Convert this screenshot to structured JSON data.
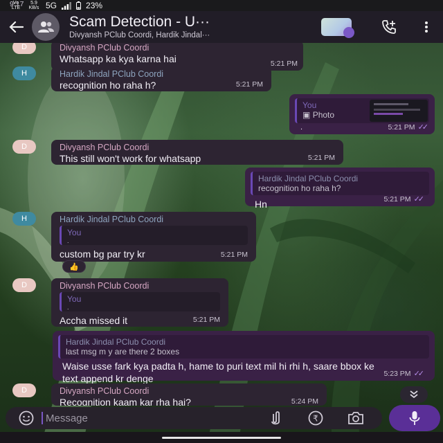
{
  "status_bar": {
    "time": "9:17",
    "volte": "Vo LTE",
    "data_speed": "5.9",
    "data_unit": "KB/s",
    "network": "5G",
    "battery": "23%"
  },
  "header": {
    "title": "Scam Detection - U···",
    "subtitle": "Divyansh PClub Coordi, Hardik Jindal···",
    "icons": [
      "back-arrow-icon",
      "group-icon",
      "call-add-icon",
      "more-vert-icon"
    ]
  },
  "messages": [
    {
      "type": "in",
      "avatar": "D",
      "sender": "Divyansh PClub Coordi",
      "text": "Whatsapp ka kya karna hai",
      "time": "5:21 PM"
    },
    {
      "type": "in",
      "avatar": "H",
      "sender": "Hardik Jindal PClub Coordi",
      "text": "recognition ho raha h?",
      "time": "5:21 PM"
    },
    {
      "type": "out",
      "quote_name": "You",
      "quote_text": "Photo",
      "text": ".",
      "time": "5:21 PM"
    },
    {
      "type": "in",
      "avatar": "D",
      "sender": "Divyansh PClub Coordi",
      "text": "This still won't work for whatsapp",
      "time": "5:21 PM"
    },
    {
      "type": "out",
      "quote_name": "Hardik Jindal PClub Coordi",
      "quote_text": "recognition ho raha h?",
      "text": "Hn",
      "time": "5:21 PM"
    },
    {
      "type": "in",
      "avatar": "H",
      "sender": "Hardik Jindal PClub Coordi",
      "quote_name": "You",
      "quote_text": ".",
      "text": "custom bg par try kr",
      "time": "5:21 PM"
    },
    {
      "type": "in",
      "avatar": "D",
      "sender": "Divyansh PClub Coordi",
      "quote_name": "You",
      "quote_text": ".",
      "text": "Accha missed it",
      "time": "5:21 PM"
    },
    {
      "type": "out",
      "quote_name": "Hardik Jindal PClub Coordi",
      "quote_text": "last msg m y are there 2 boxes",
      "text": "Waise usse fark kya padta h, hame to puri text mil hi rhi h, saare bbox ke text append kr denge",
      "time": "5:23 PM"
    },
    {
      "type": "in",
      "avatar": "D",
      "sender": "Divyansh PClub Coordi",
      "text": "Recognition kaam kar rha hai?",
      "time": "5:24 PM"
    }
  ],
  "composer": {
    "placeholder": "Message",
    "icons": [
      "emoji-icon",
      "attach-icon",
      "rupee-icon",
      "camera-icon",
      "mic-icon"
    ]
  },
  "colors": {
    "incoming_bubble": "#2d2432",
    "outgoing_bubble": "#3a2146",
    "accent": "#5a2f97",
    "read_ticks": "#b58ce8"
  }
}
